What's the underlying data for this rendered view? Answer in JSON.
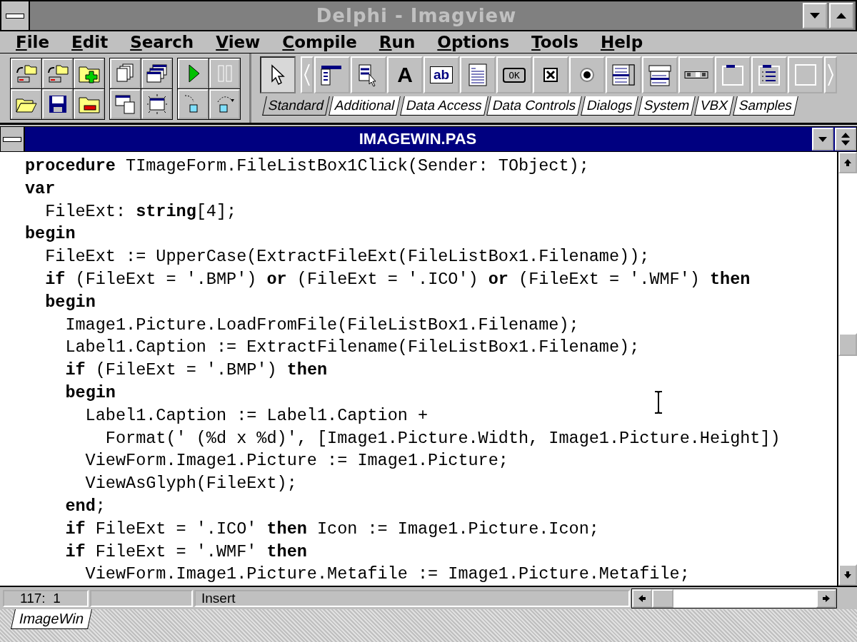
{
  "window": {
    "title": "Delphi - Imagview"
  },
  "menu": [
    "File",
    "Edit",
    "Search",
    "View",
    "Compile",
    "Run",
    "Options",
    "Tools",
    "Help"
  ],
  "palette": {
    "glyphs": {
      "label": "A",
      "edit": "ab",
      "button": "OK"
    },
    "tabs": [
      {
        "label": "Standard",
        "selected": true
      },
      {
        "label": "Additional",
        "selected": false
      },
      {
        "label": "Data Access",
        "selected": false
      },
      {
        "label": "Data Controls",
        "selected": false
      },
      {
        "label": "Dialogs",
        "selected": false
      },
      {
        "label": "System",
        "selected": false
      },
      {
        "label": "VBX",
        "selected": false
      },
      {
        "label": "Samples",
        "selected": false
      }
    ]
  },
  "editor": {
    "title": "IMAGEWIN.PAS",
    "lines": [
      "**procedure** TImageForm.FileListBox1Click(Sender: TObject);",
      "**var**",
      "  FileExt: **string**[4];",
      "**begin**",
      "  FileExt := UpperCase(ExtractFileExt(FileListBox1.Filename));",
      "  **if** (FileExt = '.BMP') **or** (FileExt = '.ICO') **or** (FileExt = '.WMF') **then**",
      "  **begin**",
      "    Image1.Picture.LoadFromFile(FileListBox1.Filename);",
      "    Label1.Caption := ExtractFilename(FileListBox1.Filename);",
      "    **if** (FileExt = '.BMP') **then**",
      "    **begin**",
      "      Label1.Caption := Label1.Caption +",
      "        Format(' (%d x %d)', [Image1.Picture.Width, Image1.Picture.Height])",
      "      ViewForm.Image1.Picture := Image1.Picture;",
      "      ViewAsGlyph(FileExt);",
      "    **end**;",
      "    **if** FileExt = '.ICO' **then** Icon := Image1.Picture.Icon;",
      "    **if** FileExt = '.WMF' **then**",
      "      ViewForm.Image1.Picture.Metafile := Image1.Picture.Metafile;"
    ],
    "status_bar": {
      "position": "117:  1",
      "mode": "Insert"
    },
    "tabs": [
      {
        "label": "ImageWin",
        "selected": true
      }
    ]
  }
}
